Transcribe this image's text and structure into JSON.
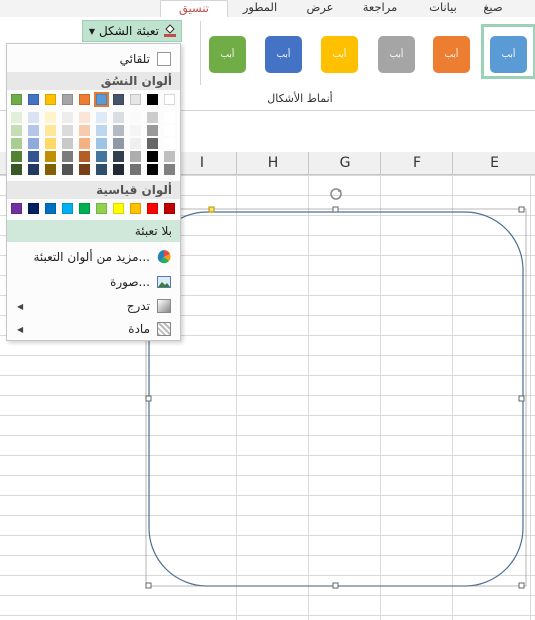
{
  "ribbon": {
    "tabs": [
      {
        "label": "صيغ"
      },
      {
        "label": "بيانات"
      },
      {
        "label": "مراجعة"
      },
      {
        "label": "عرض"
      },
      {
        "label": "المطور"
      },
      {
        "label": "تنسيق"
      }
    ],
    "shape_fill_button": "تعبئة الشكل",
    "shape_styles_group_label": "أنماط الأشكال",
    "style_swatch_text": "أبب",
    "style_swatches": [
      {
        "color": "#5b9bd5"
      },
      {
        "color": "#ed7d31"
      },
      {
        "color": "#a5a5a5"
      },
      {
        "color": "#ffc000"
      },
      {
        "color": "#4472c4"
      },
      {
        "color": "#70ad47"
      }
    ]
  },
  "fill_menu": {
    "automatic": "تلقائي",
    "theme_colors_header": "ألوان النسُق",
    "theme_colors_top": [
      "#ffffff",
      "#000000",
      "#e7e6e6",
      "#44546a",
      "#5b9bd5",
      "#ed7d31",
      "#a5a5a5",
      "#ffc000",
      "#4472c4",
      "#70ad47"
    ],
    "standard_colors_header": "ألوان قياسية",
    "standard_colors": [
      "#c00000",
      "#ff0000",
      "#ffc000",
      "#ffff00",
      "#92d050",
      "#00b050",
      "#00b0f0",
      "#0070c0",
      "#002060",
      "#7030a0"
    ],
    "no_fill": "بلا تعبئة",
    "more_fill_colors": "مزيد من ألوان التعبئة...",
    "picture": "صورة...",
    "gradient": "تدرج",
    "texture": "مادة"
  },
  "sheet": {
    "columns": [
      "E",
      "F",
      "G",
      "H",
      "I"
    ]
  }
}
